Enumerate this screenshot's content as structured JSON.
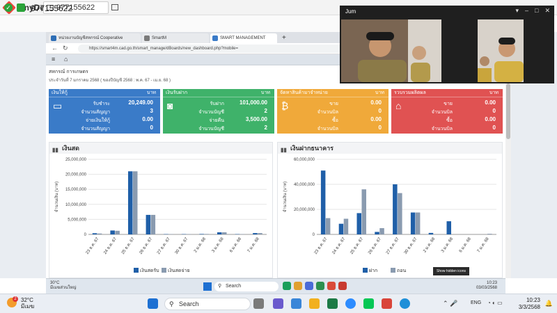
{
  "anydesk": {
    "app_title": "AnyDesk",
    "session_tab": "977155622",
    "session_id": "977155622"
  },
  "browser": {
    "tabs": [
      "หน่วยงานบัญชีสหกรณ์ Cooperative",
      "SmartM",
      "SMART MANAGEMENT"
    ],
    "url": "https://smart4m.cad.go.th/smart_manage/dBoards/new_dashboard.php?mobile="
  },
  "page": {
    "org_title": "สหกรณ์ การเกษตร",
    "date_line": "ประจำวันที่ 7 มกราคม 2568 ( ของปีบัญชี 2568 : พ.ค. 67 - เม.ย. 68 )",
    "cards": [
      {
        "title": "เงินให้กู้",
        "unit": "บาท",
        "icon": "credit-card-icon",
        "color": "#3a7bc8",
        "rows": [
          {
            "label": "รับชำระ",
            "value": "20,249.00"
          },
          {
            "label": "จำนวนสัญญา",
            "value": "3"
          },
          {
            "label": "จ่ายเงินให้กู้",
            "value": "0.00"
          },
          {
            "label": "จำนวนสัญญา",
            "value": "0"
          }
        ]
      },
      {
        "title": "เงินรับฝาก",
        "unit": "บาท",
        "icon": "money-bill-icon",
        "color": "#3fb26a",
        "rows": [
          {
            "label": "รับฝาก",
            "value": "101,000.00"
          },
          {
            "label": "จำนวนบัญชี",
            "value": "2"
          },
          {
            "label": "จ่ายคืน",
            "value": "3,500.00"
          },
          {
            "label": "จำนวนบัญชี",
            "value": "2"
          }
        ]
      },
      {
        "title": "จัดหาสินค้ามาจำหน่าย",
        "unit": "บาท",
        "icon": "bitcoin-icon",
        "color": "#f0a93a",
        "rows": [
          {
            "label": "ขาย",
            "value": "0.00"
          },
          {
            "label": "จำนวนบิล",
            "value": "0"
          },
          {
            "label": "ซื้อ",
            "value": "0.00"
          },
          {
            "label": "จำนวนบิล",
            "value": "0"
          }
        ]
      },
      {
        "title": "รวบรวมผลิตผล",
        "unit": "บาท",
        "icon": "bank-icon",
        "color": "#e05252",
        "rows": [
          {
            "label": "ขาย",
            "value": "0.00"
          },
          {
            "label": "จำนวนบิล",
            "value": "0"
          },
          {
            "label": "ซื้อ",
            "value": "0.00"
          },
          {
            "label": "จำนวนบิล",
            "value": "0"
          }
        ]
      }
    ]
  },
  "chart_data": [
    {
      "type": "bar",
      "title": "เงินสด",
      "ylabel": "จำนวนเงิน (บาท)",
      "ylim": [
        0,
        25000000
      ],
      "yticks": [
        "0",
        "5,000,000",
        "10,000,000",
        "15,000,000",
        "20,000,000",
        "25,000,000"
      ],
      "categories": [
        "23 ธ.ค. 67",
        "24 ธ.ค. 67",
        "25 ธ.ค. 67",
        "26 ธ.ค. 67",
        "27 ธ.ค. 67",
        "30 ธ.ค. 67",
        "2 ม.ค. 68",
        "3 ม.ค. 68",
        "6 ม.ค. 68",
        "7 ม.ค. 68"
      ],
      "series": [
        {
          "name": "เงินสดรับ",
          "color": "#1f5fa8",
          "values": [
            400000,
            1300000,
            21000000,
            6500000,
            100000,
            100000,
            150000,
            700000,
            100000,
            450000
          ]
        },
        {
          "name": "เงินสดจ่าย",
          "color": "#8a9bb0",
          "values": [
            300000,
            1200000,
            21000000,
            6500000,
            100000,
            100000,
            150000,
            700000,
            100000,
            450000
          ]
        }
      ]
    },
    {
      "type": "bar",
      "title": "เงินฝากธนาคาร",
      "ylabel": "จำนวนเงิน (บาท)",
      "ylim": [
        0,
        60000000
      ],
      "yticks": [
        "0",
        "20,000,000",
        "40,000,000",
        "60,000,000"
      ],
      "categories": [
        "23 ธ.ค. 67",
        "24 ธ.ค. 67",
        "25 ธ.ค. 67",
        "26 ธ.ค. 67",
        "27 ธ.ค. 67",
        "30 ธ.ค. 67",
        "2 ม.ค. 68",
        "3 ม.ค. 68",
        "6 ม.ค. 68",
        "7 ม.ค. 68"
      ],
      "series": [
        {
          "name": "ฝาก",
          "color": "#1f5fa8",
          "values": [
            51000000,
            8500000,
            17000000,
            2000000,
            40000000,
            17500000,
            1200000,
            10500000,
            0,
            0
          ]
        },
        {
          "name": "ถอน",
          "color": "#8a9bb0",
          "values": [
            13000000,
            12500000,
            36000000,
            5000000,
            33000000,
            17500000,
            0,
            0,
            0,
            500000
          ]
        }
      ]
    }
  ],
  "video_call": {
    "title": "Jum"
  },
  "remote_taskbar": {
    "weather_temp": "30°C",
    "weather_desc": "มีเมฆส่วนใหญ่",
    "search_placeholder": "Search",
    "time": "10:23",
    "date": "03/03/2568",
    "tooltip": "Show hidden icons"
  },
  "local_taskbar": {
    "badge": "2",
    "temp": "32°C",
    "weather_desc": "มีเมฆ",
    "search_placeholder": "Search",
    "lang": "ENG",
    "time": "10:23",
    "date": "3/3/2568"
  }
}
